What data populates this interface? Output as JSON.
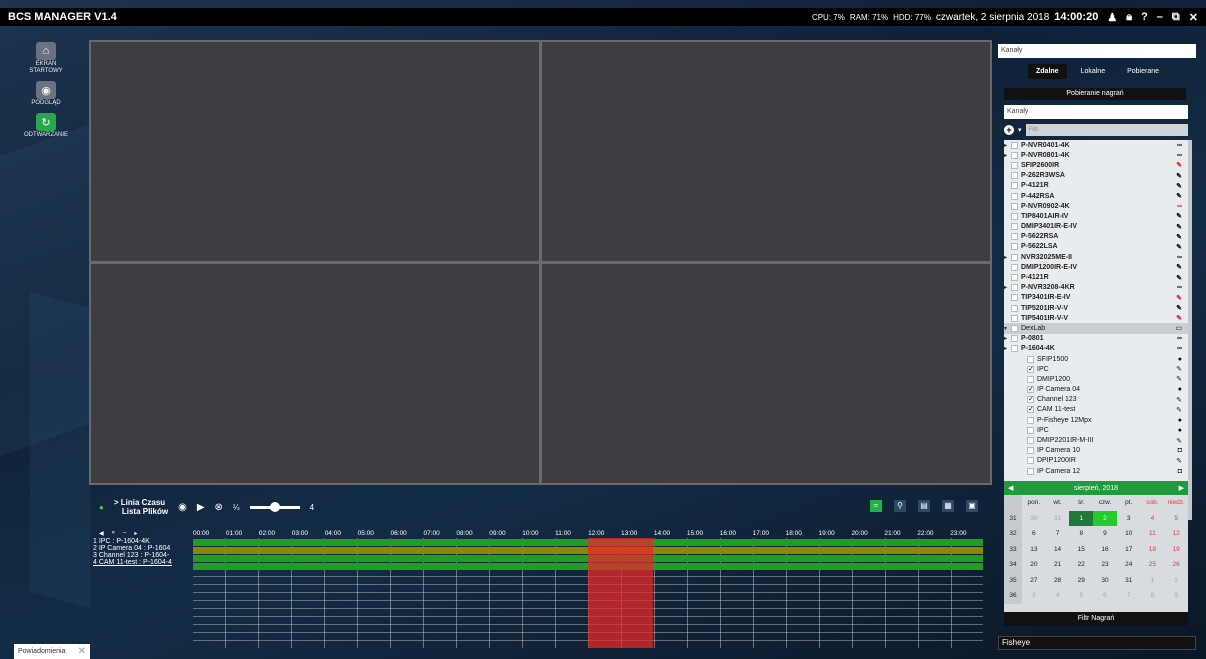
{
  "titlebar": {
    "app_title": "BCS MANAGER V1.4",
    "cpu": "CPU:  7%",
    "ram": "RAM:  71%",
    "hdd": "HDD:  77%",
    "date": "czwartek, 2 sierpnia 2018",
    "time": "14:00:20"
  },
  "leftnav": [
    {
      "label": "EKRAN STARTOWY",
      "icon": "home-icon"
    },
    {
      "label": "PODGLĄD",
      "icon": "eye-icon"
    },
    {
      "label": "ODTWARZANIE",
      "icon": "playback-icon"
    }
  ],
  "right": {
    "kanaly_top": "Kanały",
    "tabs": [
      "Zdalne",
      "Lokalne",
      "Pobierane"
    ],
    "pobieranie": "Pobieranie nagrań",
    "kanaly_sub": "Kanały",
    "filter_placeholder": "Filtr",
    "tree": [
      {
        "label": "P-NVR0401-4K",
        "bold": true,
        "exp": true,
        "icon": "∞"
      },
      {
        "label": "P-NVR0801-4K",
        "bold": true,
        "exp": true,
        "icon": "∞"
      },
      {
        "label": "SFIP2600IR",
        "bold": true,
        "icon": "✎",
        "red": true
      },
      {
        "label": "P-262R3WSA",
        "bold": true,
        "icon": "✎"
      },
      {
        "label": "P-4121R",
        "bold": true,
        "icon": "✎"
      },
      {
        "label": "P-442RSA",
        "bold": true,
        "icon": "✎"
      },
      {
        "label": "P-NVR0902-4K",
        "bold": true,
        "icon": "∞",
        "red": true
      },
      {
        "label": "TIP8401AIR-IV",
        "bold": true,
        "icon": "✎"
      },
      {
        "label": "DMIP3401IR-E-IV",
        "bold": true,
        "icon": "✎"
      },
      {
        "label": "P-5622RSA",
        "bold": true,
        "icon": "✎"
      },
      {
        "label": "P-5622LSA",
        "bold": true,
        "icon": "✎"
      },
      {
        "label": "NVR32025ME-II",
        "bold": true,
        "exp": true,
        "icon": "∞"
      },
      {
        "label": "DMIP1200IR-E-IV",
        "bold": true,
        "icon": "✎"
      },
      {
        "label": "P-4121R",
        "bold": true,
        "icon": "✎"
      },
      {
        "label": "P-NVR3208-4KR",
        "bold": true,
        "exp": true,
        "icon": "∞"
      },
      {
        "label": "TIP3401IR-E-IV",
        "bold": true,
        "icon": "✎",
        "red": true
      },
      {
        "label": "TIP5201IR-V-V",
        "bold": true,
        "icon": "✎"
      },
      {
        "label": "TIP5401IR-V-V",
        "bold": true,
        "icon": "✎",
        "red": true
      },
      {
        "label": "DexLab",
        "group": true,
        "icon": "▭"
      },
      {
        "label": "P-0801",
        "bold": true,
        "exp": true,
        "icon": "∞"
      },
      {
        "label": "P-1604-4K",
        "bold": true,
        "exp": true,
        "icon": "∞"
      },
      {
        "label": "SFIP1500",
        "icon": "●",
        "indent": true
      },
      {
        "label": "IPC",
        "checked": true,
        "icon": "✎",
        "indent": true
      },
      {
        "label": "DMIP1200",
        "icon": "✎",
        "indent": true
      },
      {
        "label": "IP Camera 04",
        "checked": true,
        "icon": "●",
        "indent": true
      },
      {
        "label": "Channel 123",
        "checked": true,
        "icon": "✎",
        "indent": true
      },
      {
        "label": "CAM 11-test",
        "checked": true,
        "icon": "✎",
        "indent": true
      },
      {
        "label": "P-Fisheye 12Mpx",
        "icon": "●",
        "indent": true
      },
      {
        "label": "IPC",
        "icon": "●",
        "indent": true
      },
      {
        "label": "DMIP2201IR-M-III",
        "icon": "✎",
        "indent": true
      },
      {
        "label": "IP Camera 10",
        "icon": "◘",
        "indent": true
      },
      {
        "label": "DPIP1200IR",
        "icon": "✎",
        "indent": true
      },
      {
        "label": "IP Camera 12",
        "icon": "◘",
        "indent": true
      }
    ],
    "calendar": {
      "month": "sierpień",
      "year": "2018",
      "weekdays": [
        "pon.",
        "wt.",
        "śr.",
        "czw.",
        "pt.",
        "sob.",
        "niedz."
      ],
      "weeks": [
        {
          "wk": "31",
          "days": [
            "30",
            "31",
            "1",
            "2",
            "3",
            "4",
            "5"
          ]
        },
        {
          "wk": "32",
          "days": [
            "6",
            "7",
            "8",
            "9",
            "10",
            "11",
            "12"
          ]
        },
        {
          "wk": "33",
          "days": [
            "13",
            "14",
            "15",
            "16",
            "17",
            "18",
            "19"
          ]
        },
        {
          "wk": "34",
          "days": [
            "20",
            "21",
            "22",
            "23",
            "24",
            "25",
            "26"
          ]
        },
        {
          "wk": "35",
          "days": [
            "27",
            "28",
            "29",
            "30",
            "31",
            "1",
            "2"
          ]
        },
        {
          "wk": "36",
          "days": [
            "3",
            "4",
            "5",
            "6",
            "7",
            "8",
            "9"
          ]
        }
      ]
    },
    "filtr_nagran": "Filtr Nagrań",
    "fisheye": "Fisheye"
  },
  "timeline": {
    "linia": "> Linia Czasu",
    "lista": "Lista Plików",
    "speed": "¼",
    "speed_max": "4",
    "cams": [
      "1   IPC : P-1604-4K",
      "2   IP Camera 04 : P-1604",
      "3   Channel 123 : P-1604-",
      "4   CAM 11-test : P-1604-4"
    ],
    "hours": [
      "00:00",
      "01:00",
      "02:00",
      "03:00",
      "04:00",
      "05:00",
      "06:00",
      "07:00",
      "08:00",
      "09:00",
      "10:00",
      "11:00",
      "12:00",
      "13:00",
      "14:00",
      "15:00",
      "16:00",
      "17:00",
      "18:00",
      "19:00",
      "20:00",
      "21:00",
      "22:00",
      "23:00"
    ]
  },
  "notifications": "Powiadomienia"
}
